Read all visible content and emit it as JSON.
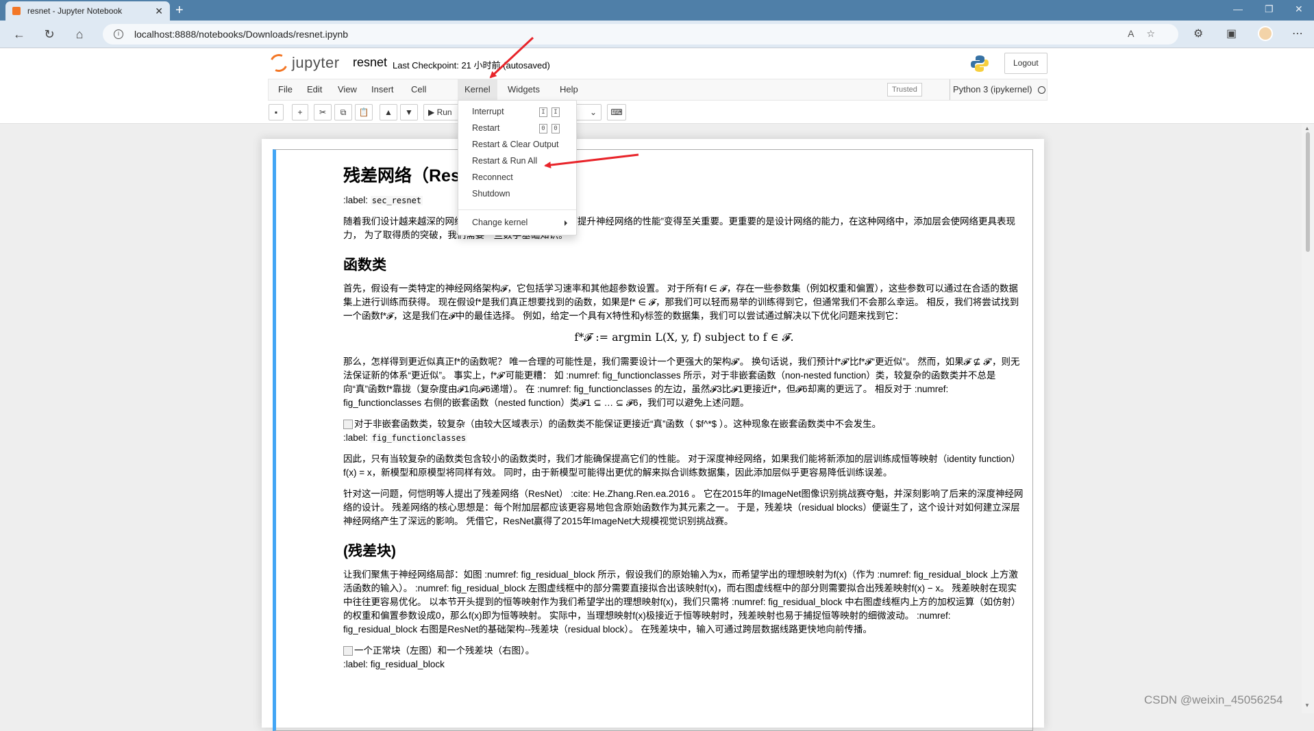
{
  "browser": {
    "tab_title": "resnet - Jupyter Notebook",
    "url": "localhost:8888/notebooks/Downloads/resnet.ipynb"
  },
  "header": {
    "logo_text": "jupyter",
    "notebook_name": "resnet",
    "checkpoint": "Last Checkpoint: 21 小时前  (autosaved)",
    "logout": "Logout"
  },
  "menubar": {
    "items": [
      "File",
      "Edit",
      "View",
      "Insert",
      "Cell",
      "Kernel",
      "Widgets",
      "Help"
    ],
    "active": "Kernel",
    "trusted": "Trusted",
    "kernel": "Python 3 (ipykernel)"
  },
  "toolbar": {
    "run_label": "Run"
  },
  "kernel_menu": {
    "items": [
      {
        "label": "Interrupt",
        "shortcut": [
          "I",
          "I"
        ]
      },
      {
        "label": "Restart",
        "shortcut": [
          "0",
          "0"
        ]
      },
      {
        "label": "Restart & Clear Output"
      },
      {
        "label": "Restart & Run All"
      },
      {
        "label": "Reconnect"
      },
      {
        "label": "Shutdown"
      },
      {
        "label": "Change kernel"
      }
    ]
  },
  "notebook": {
    "h1": "残差网络（ResNet）",
    "label1_prefix": ":label: ",
    "label1_code": "sec_resnet",
    "p1": "随着我们设计越来越深的网络，深刻理解“新添加的层如何提升神经网络的性能”变得至关重要。更重要的是设计网络的能力，在这种网络中，添加层会使网络更具表现力， 为了取得质的突破，我们需要一些数学基础知识。",
    "h2a": "函数类",
    "p2": "首先，假设有一类特定的神经网络架构𝓕，它包括学习速率和其他超参数设置。 对于所有f ∈ 𝓕，存在一些参数集（例如权重和偏置），这些参数可以通过在合适的数据集上进行训练而获得。 现在假设f*是我们真正想要找到的函数，如果是f* ∈ 𝓕，那我们可以轻而易举的训练得到它，但通常我们不会那么幸运。 相反，我们将尝试找到一个函数f*𝓕，这是我们在𝓕中的最佳选择。 例如，给定一个具有X特性和y标签的数据集，我们可以尝试通过解决以下优化问题来找到它：",
    "eq": "f*𝓕 := argmin L(X, y, f) subject to f ∈ 𝓕.",
    "p3": "那么，怎样得到更近似真正f*的函数呢？ 唯一合理的可能性是，我们需要设计一个更强大的架构𝓕′。 换句话说，我们预计f*𝓕′比f*𝓕“更近似”。 然而，如果𝓕 ⊈ 𝓕′，则无法保证新的体系“更近似”。 事实上，f*𝓕′可能更糟： 如 :numref: fig_functionclasses 所示，对于非嵌套函数（non-nested function）类，较复杂的函数类并不总是向“真”函数f*靠拢（复杂度由𝓕1向𝓕6递增）。 在 :numref: fig_functionclasses 的左边，虽然𝓕3比𝓕1更接近f*，但𝓕6却离的更远了。 相反对于 :numref: fig_functionclasses 右侧的嵌套函数（nested function）类𝓕1 ⊆ … ⊆ 𝓕6，我们可以避免上述问题。",
    "img1_alt": "对于非嵌套函数类，较复杂（由较大区域表示）的函数类不能保证更接近“真”函数（ $f^*$ ）。这种现象在嵌套函数类中不会发生。",
    "label2_prefix": ":label: ",
    "label2_code": "fig_functionclasses",
    "p4": "因此，只有当较复杂的函数类包含较小的函数类时，我们才能确保提高它们的性能。 对于深度神经网络，如果我们能将新添加的层训练成恒等映射（identity function）f(x) = x，新模型和原模型将同样有效。 同时，由于新模型可能得出更优的解来拟合训练数据集，因此添加层似乎更容易降低训练误差。",
    "p5": "针对这一问题，何恺明等人提出了残差网络（ResNet） :cite: He.Zhang.Ren.ea.2016 。 它在2015年的ImageNet图像识别挑战赛夺魁，并深刻影响了后来的深度神经网络的设计。 残差网络的核心思想是：每个附加层都应该更容易地包含原始函数作为其元素之一。 于是，残差块（residual blocks）便诞生了，这个设计对如何建立深层神经网络产生了深远的影响。 凭借它，ResNet赢得了2015年ImageNet大规模视觉识别挑战赛。",
    "h2b": "(残差块)",
    "p6": "让我们聚焦于神经网络局部：如图 :numref: fig_residual_block 所示，假设我们的原始输入为x，而希望学出的理想映射为f(x)（作为 :numref: fig_residual_block 上方激活函数的输入）。 :numref: fig_residual_block 左图虚线框中的部分需要直接拟合出该映射f(x)，而右图虚线框中的部分则需要拟合出残差映射f(x) − x。 残差映射在现实中往往更容易优化。 以本节开头提到的恒等映射作为我们希望学出的理想映射f(x)，我们只需将 :numref: fig_residual_block 中右图虚线框内上方的加权运算（如仿射）的权重和偏置参数设成0，那么f(x)即为恒等映射。 实际中，当理想映射f(x)极接近于恒等映射时，残差映射也易于捕捉恒等映射的细微波动。 :numref: fig_residual_block 右图是ResNet的基础架构--残差块（residual block）。 在残差块中，输入可通过跨层数据线路更快地向前传播。",
    "img2_alt": "一个正常块（左图）和一个残差块（右图）。",
    "label3": ":label: fig_residual_block"
  },
  "watermark": "CSDN @weixin_45056254",
  "colors": {
    "jupyter_orange": "#f37726",
    "cell_selected": "#42a5f5",
    "annotation_red": "#e8242a"
  }
}
